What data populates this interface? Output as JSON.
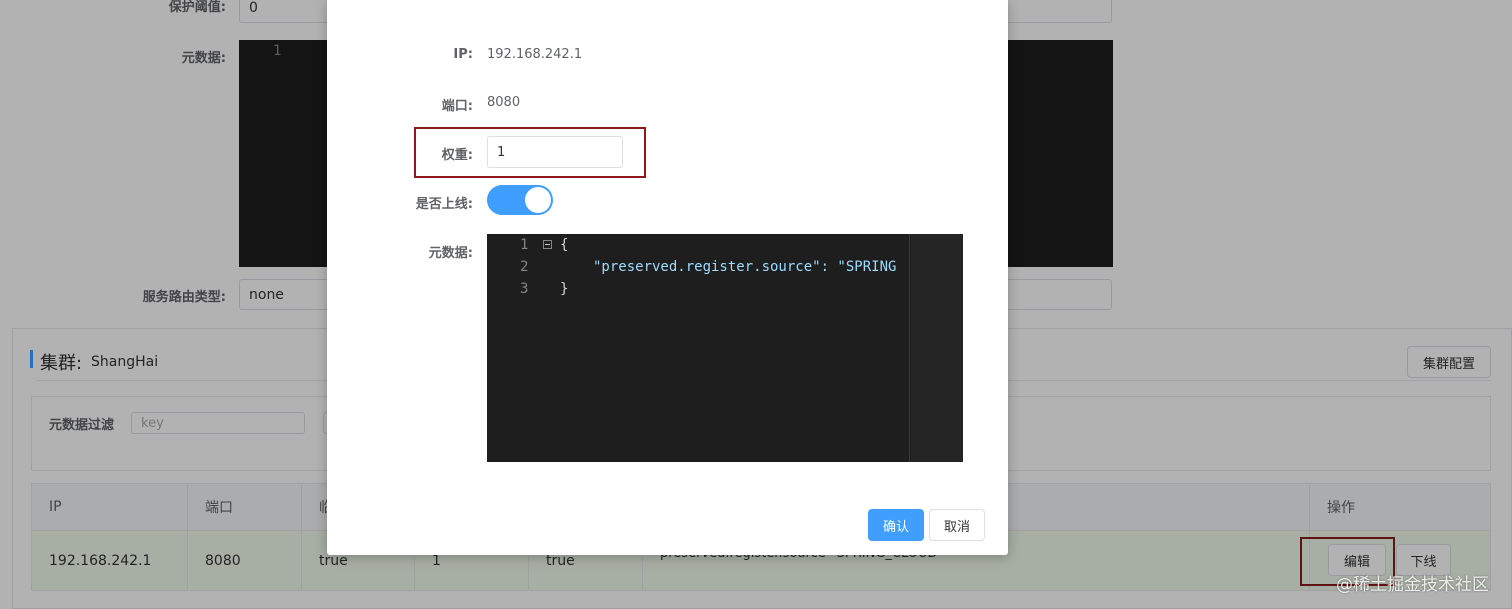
{
  "background": {
    "protect_threshold": {
      "label": "保护阈值:",
      "value": "0"
    },
    "metadata": {
      "label": "元数据:",
      "line_number": "1"
    },
    "route_type": {
      "label": "服务路由类型:",
      "value": "none"
    },
    "cluster": {
      "title": "集群:",
      "name": "ShangHai",
      "config_button": "集群配置",
      "filter_label": "元数据过滤",
      "filter_key_placeholder": "key"
    },
    "table": {
      "headers": [
        "IP",
        "端口",
        "临",
        "操作"
      ],
      "row": {
        "ip": "192.168.242.1",
        "port": "8080",
        "ephemeral": "true",
        "weight": "1",
        "healthy": "true",
        "metadata": "preserved.register.source=SPRING_CLOUD",
        "edit_button": "编辑",
        "offline_button": "下线"
      }
    },
    "watermark": "@稀土掘金技术社区"
  },
  "modal": {
    "ip": {
      "label": "IP:",
      "value": "192.168.242.1"
    },
    "port": {
      "label": "端口:",
      "value": "8080"
    },
    "weight": {
      "label": "权重:",
      "value": "1"
    },
    "online": {
      "label": "是否上线:",
      "enabled": true
    },
    "metadata": {
      "label": "元数据:",
      "line_numbers": [
        "1",
        "2",
        "3"
      ],
      "lines": [
        "{",
        "\"preserved.register.source\": \"SPRING",
        "}"
      ]
    },
    "confirm_button": "确认",
    "cancel_button": "取消"
  },
  "colors": {
    "accent": "#409eff",
    "highlight_border": "#8b1a1a",
    "row_selected": "#f0f9eb",
    "editor_bg": "#1e1e1e"
  }
}
